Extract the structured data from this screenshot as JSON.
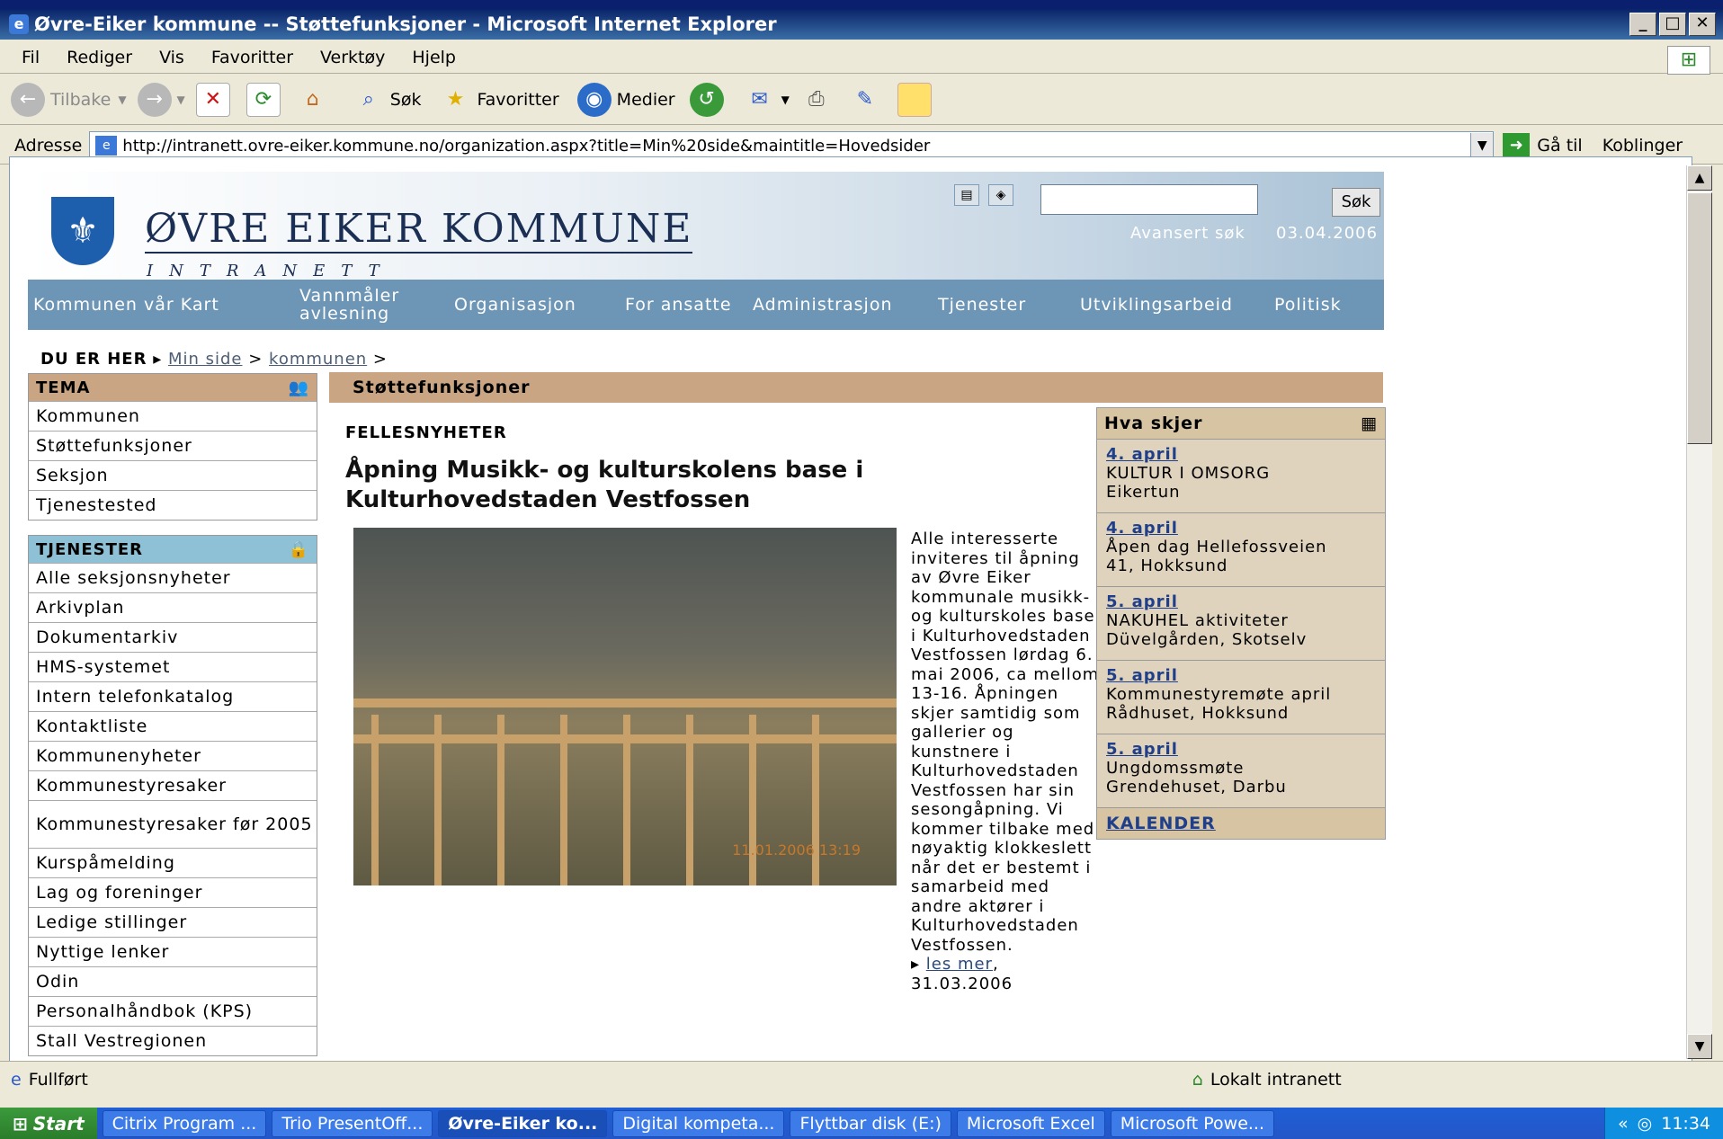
{
  "window": {
    "title": "Øvre-Eiker kommune -- Støttefunksjoner - Microsoft Internet Explorer"
  },
  "menu": [
    "Fil",
    "Rediger",
    "Vis",
    "Favoritter",
    "Verktøy",
    "Hjelp"
  ],
  "toolbar": {
    "back": "Tilbake",
    "search": "Søk",
    "favorites": "Favoritter",
    "media": "Medier"
  },
  "address": {
    "label": "Adresse",
    "url": "http://intranett.ovre-eiker.kommune.no/organization.aspx?title=Min%20side&maintitle=Hovedsider",
    "go": "Gå til",
    "links": "Koblinger"
  },
  "site": {
    "name": "ØVRE EIKER KOMMUNE",
    "subtitle": "INTRANETT",
    "search_button": "Søk",
    "advanced_search": "Avansert søk",
    "date": "03.04.2006",
    "nav": [
      "Kommunen vår Kart",
      "Vannmåler avlesning",
      "Organisasjon",
      "For ansatte",
      "Administrasjon",
      "Tjenester",
      "Utviklingsarbeid",
      "Politisk"
    ]
  },
  "breadcrumb": {
    "label": "DU ER HER",
    "items": [
      "Min side",
      "kommunen"
    ]
  },
  "tema": {
    "title": "TEMA",
    "items": [
      "Kommunen",
      "Støttefunksjoner",
      "Seksjon",
      "Tjenestested"
    ]
  },
  "tjenester": {
    "title": "TJENESTER",
    "items": [
      "Alle seksjonsnyheter",
      "Arkivplan",
      "Dokumentarkiv",
      "HMS-systemet",
      "Intern telefonkatalog",
      "Kontaktliste",
      "Kommunenyheter",
      "Kommunestyresaker",
      "Kommunestyresaker før 2005",
      "Kurspåmelding",
      "Lag og foreninger",
      "Ledige stillinger",
      "Nyttige lenker",
      "Odin",
      "Personalhåndbok (KPS)",
      "Stall Vestregionen"
    ]
  },
  "section": {
    "title": "Støttefunksjoner"
  },
  "news": {
    "label": "FELLESNYHETER",
    "headline": "Åpning Musikk- og kulturskolens base i Kulturhovedstaden Vestfossen",
    "photo_stamp": "11.01.2006 13:19",
    "body": "Alle interesserte inviteres til åpning av Øvre Eiker kommunale musikk- og kulturskoles base i Kulturhovedstaden Vestfossen lørdag 6. mai 2006, ca mellom 13-16. Åpningen skjer samtidig som gallerier og kunstnere i Kulturhovedstaden Vestfossen har sin sesongåpning. Vi kommer tilbake med nøyaktig klokkeslett når det er bestemt i samarbeid med andre aktører i Kulturhovedstaden Vestfossen.",
    "more": "les mer",
    "date": ",\n31.03.2006"
  },
  "events": {
    "title": "Hva skjer",
    "items": [
      {
        "date": "4. april",
        "title": "KULTUR I OMSORG",
        "place": "Eikertun"
      },
      {
        "date": "4. april",
        "title": "Åpen dag Hellefossveien",
        "place": "41, Hokksund"
      },
      {
        "date": "5. april",
        "title": "NAKUHEL aktiviteter",
        "place": "Düvelgården, Skotselv"
      },
      {
        "date": "5. april",
        "title": "Kommunestyremøte april",
        "place": "Rådhuset, Hokksund"
      },
      {
        "date": "5. april",
        "title": "Ungdomssmøte",
        "place": "Grendehuset, Darbu"
      }
    ],
    "calendar": "KALENDER"
  },
  "status": {
    "text": "Fullført",
    "zone": "Lokalt intranett"
  },
  "taskbar": {
    "start": "Start",
    "tasks": [
      "Citrix Program ...",
      "Trio PresentOff...",
      "Øvre-Eiker ko...",
      "Digital kompeta...",
      "Flyttbar disk (E:)",
      "Microsoft Excel",
      "Microsoft Powe..."
    ],
    "clock": "11:34"
  }
}
